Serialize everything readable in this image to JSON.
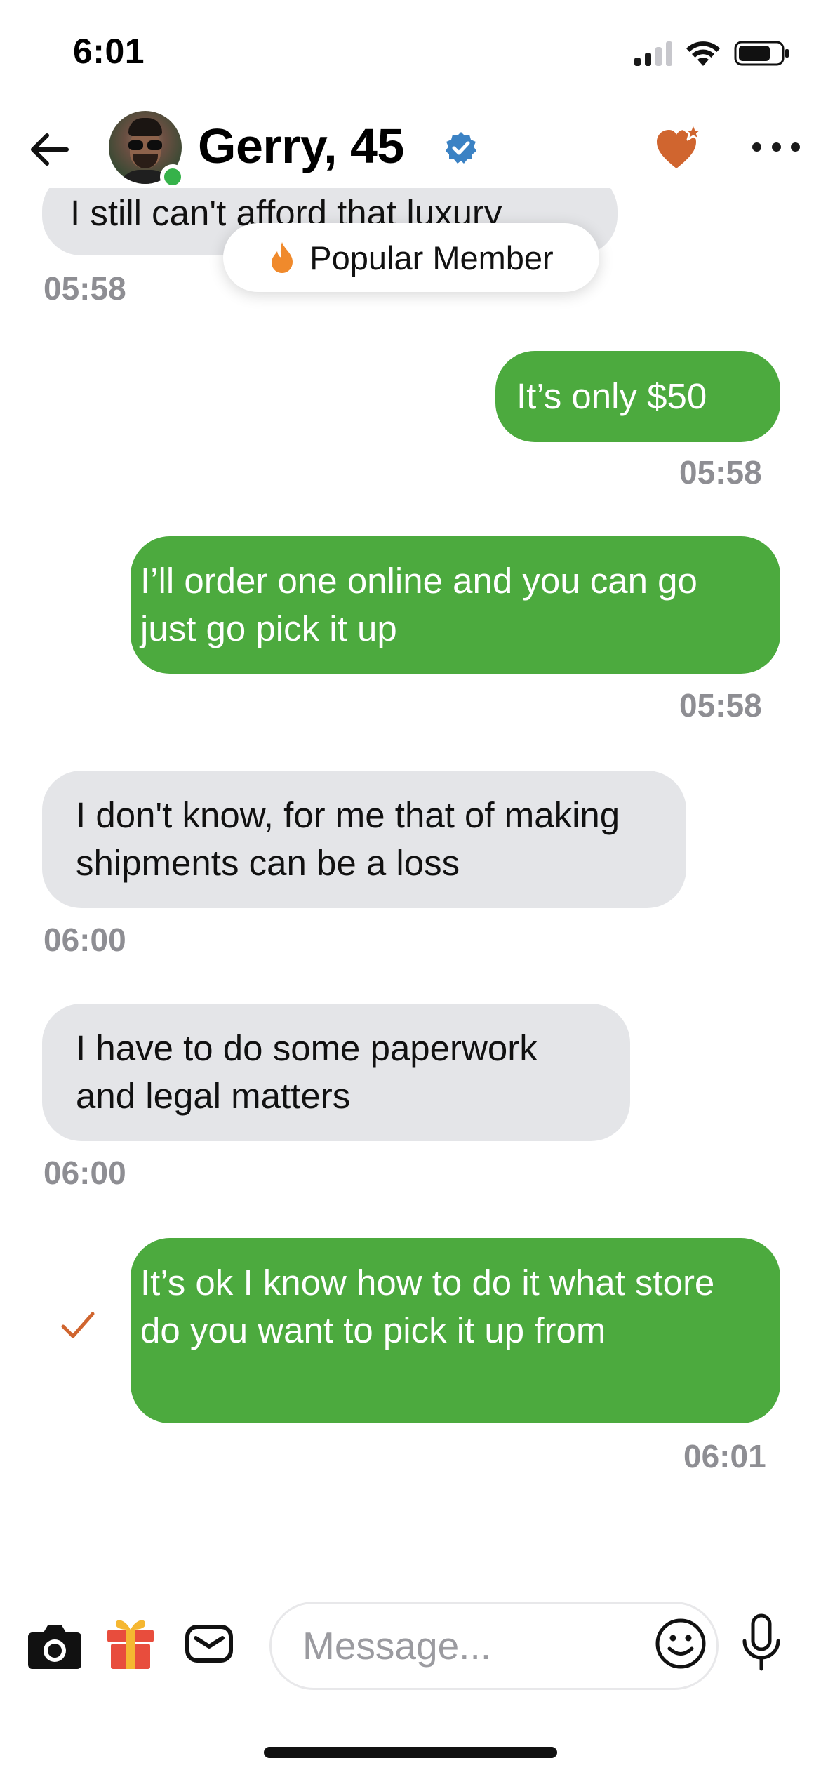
{
  "status_bar": {
    "time": "6:01"
  },
  "header": {
    "name_age": "Gerry, 45",
    "back_label": "Back",
    "verified": true,
    "online": true
  },
  "badge": {
    "label": "Popular Member",
    "icon": "flame-icon"
  },
  "messages": [
    {
      "direction": "received",
      "text": "I still can't afford that luxury",
      "time": "05:58"
    },
    {
      "direction": "sent",
      "text": "It’s only $50",
      "time": "05:58"
    },
    {
      "direction": "sent",
      "text": "I’ll order one online and you can go just go pick it up",
      "time": "05:58"
    },
    {
      "direction": "received",
      "text": "I don't know, for me that of making shipments can be a loss",
      "time": "06:00"
    },
    {
      "direction": "received",
      "text": "I have to do some paperwork and legal matters",
      "time": "06:00"
    },
    {
      "direction": "sent",
      "text": "It’s ok  I know how to do it  what store do you want to pick it up from",
      "time": "06:01",
      "read": true
    }
  ],
  "composer": {
    "placeholder": "Message...",
    "icons": [
      "camera-icon",
      "gift-icon",
      "envelope-icon",
      "emoji-icon",
      "microphone-icon"
    ]
  },
  "colors": {
    "sent_bubble": "#4caa3e",
    "received_bubble": "#e4e5e8",
    "accent": "#d0652f",
    "verified": "#3b82c4",
    "online": "#36b24a",
    "timestamp": "#8e8e93"
  }
}
